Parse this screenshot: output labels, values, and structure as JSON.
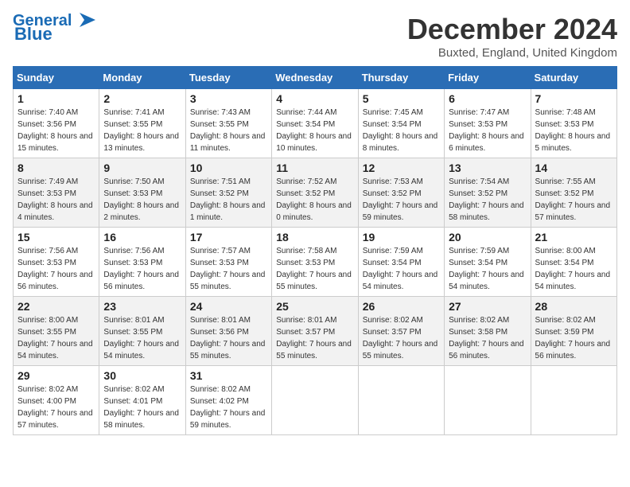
{
  "header": {
    "logo_line1": "General",
    "logo_line2": "Blue",
    "month_title": "December 2024",
    "location": "Buxted, England, United Kingdom"
  },
  "weekdays": [
    "Sunday",
    "Monday",
    "Tuesday",
    "Wednesday",
    "Thursday",
    "Friday",
    "Saturday"
  ],
  "weeks": [
    [
      {
        "day": "1",
        "sunrise": "7:40 AM",
        "sunset": "3:56 PM",
        "daylight": "8 hours and 15 minutes."
      },
      {
        "day": "2",
        "sunrise": "7:41 AM",
        "sunset": "3:55 PM",
        "daylight": "8 hours and 13 minutes."
      },
      {
        "day": "3",
        "sunrise": "7:43 AM",
        "sunset": "3:55 PM",
        "daylight": "8 hours and 11 minutes."
      },
      {
        "day": "4",
        "sunrise": "7:44 AM",
        "sunset": "3:54 PM",
        "daylight": "8 hours and 10 minutes."
      },
      {
        "day": "5",
        "sunrise": "7:45 AM",
        "sunset": "3:54 PM",
        "daylight": "8 hours and 8 minutes."
      },
      {
        "day": "6",
        "sunrise": "7:47 AM",
        "sunset": "3:53 PM",
        "daylight": "8 hours and 6 minutes."
      },
      {
        "day": "7",
        "sunrise": "7:48 AM",
        "sunset": "3:53 PM",
        "daylight": "8 hours and 5 minutes."
      }
    ],
    [
      {
        "day": "8",
        "sunrise": "7:49 AM",
        "sunset": "3:53 PM",
        "daylight": "8 hours and 4 minutes."
      },
      {
        "day": "9",
        "sunrise": "7:50 AM",
        "sunset": "3:53 PM",
        "daylight": "8 hours and 2 minutes."
      },
      {
        "day": "10",
        "sunrise": "7:51 AM",
        "sunset": "3:52 PM",
        "daylight": "8 hours and 1 minute."
      },
      {
        "day": "11",
        "sunrise": "7:52 AM",
        "sunset": "3:52 PM",
        "daylight": "8 hours and 0 minutes."
      },
      {
        "day": "12",
        "sunrise": "7:53 AM",
        "sunset": "3:52 PM",
        "daylight": "7 hours and 59 minutes."
      },
      {
        "day": "13",
        "sunrise": "7:54 AM",
        "sunset": "3:52 PM",
        "daylight": "7 hours and 58 minutes."
      },
      {
        "day": "14",
        "sunrise": "7:55 AM",
        "sunset": "3:52 PM",
        "daylight": "7 hours and 57 minutes."
      }
    ],
    [
      {
        "day": "15",
        "sunrise": "7:56 AM",
        "sunset": "3:53 PM",
        "daylight": "7 hours and 56 minutes."
      },
      {
        "day": "16",
        "sunrise": "7:56 AM",
        "sunset": "3:53 PM",
        "daylight": "7 hours and 56 minutes."
      },
      {
        "day": "17",
        "sunrise": "7:57 AM",
        "sunset": "3:53 PM",
        "daylight": "7 hours and 55 minutes."
      },
      {
        "day": "18",
        "sunrise": "7:58 AM",
        "sunset": "3:53 PM",
        "daylight": "7 hours and 55 minutes."
      },
      {
        "day": "19",
        "sunrise": "7:59 AM",
        "sunset": "3:54 PM",
        "daylight": "7 hours and 54 minutes."
      },
      {
        "day": "20",
        "sunrise": "7:59 AM",
        "sunset": "3:54 PM",
        "daylight": "7 hours and 54 minutes."
      },
      {
        "day": "21",
        "sunrise": "8:00 AM",
        "sunset": "3:54 PM",
        "daylight": "7 hours and 54 minutes."
      }
    ],
    [
      {
        "day": "22",
        "sunrise": "8:00 AM",
        "sunset": "3:55 PM",
        "daylight": "7 hours and 54 minutes."
      },
      {
        "day": "23",
        "sunrise": "8:01 AM",
        "sunset": "3:55 PM",
        "daylight": "7 hours and 54 minutes."
      },
      {
        "day": "24",
        "sunrise": "8:01 AM",
        "sunset": "3:56 PM",
        "daylight": "7 hours and 55 minutes."
      },
      {
        "day": "25",
        "sunrise": "8:01 AM",
        "sunset": "3:57 PM",
        "daylight": "7 hours and 55 minutes."
      },
      {
        "day": "26",
        "sunrise": "8:02 AM",
        "sunset": "3:57 PM",
        "daylight": "7 hours and 55 minutes."
      },
      {
        "day": "27",
        "sunrise": "8:02 AM",
        "sunset": "3:58 PM",
        "daylight": "7 hours and 56 minutes."
      },
      {
        "day": "28",
        "sunrise": "8:02 AM",
        "sunset": "3:59 PM",
        "daylight": "7 hours and 56 minutes."
      }
    ],
    [
      {
        "day": "29",
        "sunrise": "8:02 AM",
        "sunset": "4:00 PM",
        "daylight": "7 hours and 57 minutes."
      },
      {
        "day": "30",
        "sunrise": "8:02 AM",
        "sunset": "4:01 PM",
        "daylight": "7 hours and 58 minutes."
      },
      {
        "day": "31",
        "sunrise": "8:02 AM",
        "sunset": "4:02 PM",
        "daylight": "7 hours and 59 minutes."
      },
      null,
      null,
      null,
      null
    ]
  ],
  "labels": {
    "sunrise": "Sunrise:",
    "sunset": "Sunset:",
    "daylight": "Daylight:"
  }
}
